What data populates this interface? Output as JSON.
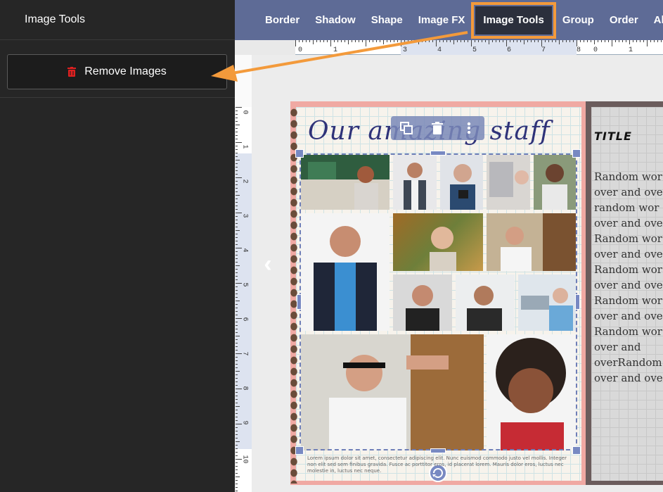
{
  "sidebar": {
    "title": "Image Tools",
    "remove_images_label": "Remove Images"
  },
  "toolbar": {
    "items": [
      "Border",
      "Shadow",
      "Shape",
      "Image FX",
      "Image Tools",
      "Group",
      "Order",
      "Alig"
    ],
    "active": "Image Tools"
  },
  "ruler": {
    "h_numbers": [
      "0",
      "1",
      "3",
      "4",
      "5",
      "6",
      "7",
      "8",
      "0",
      "1"
    ],
    "v_numbers": [
      "0",
      "1",
      "2",
      "3",
      "4",
      "5",
      "6",
      "7",
      "8",
      "9",
      "10"
    ]
  },
  "page": {
    "title": "Our amazing staff",
    "lorem": "Lorem ipsum dolor sit amet, consectetur adipiscing elit. Nunc euismod commodo justo vel mollis. Integer non elit sed sem finibus gravida. Fusce ac porttitor eros, id placerat lorem. Mauris dolor eros, luctus nec molestie in, luctus nec neque."
  },
  "page2": {
    "title": "TITLE",
    "text": "Random wor\nover and ove\nrandom wor\nover and ove\nRandom wor\nover and ove\nRandom wor\nover and ove\nRandom wor\nover and ove\nRandom wor\nover and\noverRandom\nover and ove"
  },
  "colors": {
    "toolbar": "#5e6b96",
    "highlight": "#f39a3b",
    "sidebar": "#262626",
    "selection": "#6f7fb8"
  }
}
